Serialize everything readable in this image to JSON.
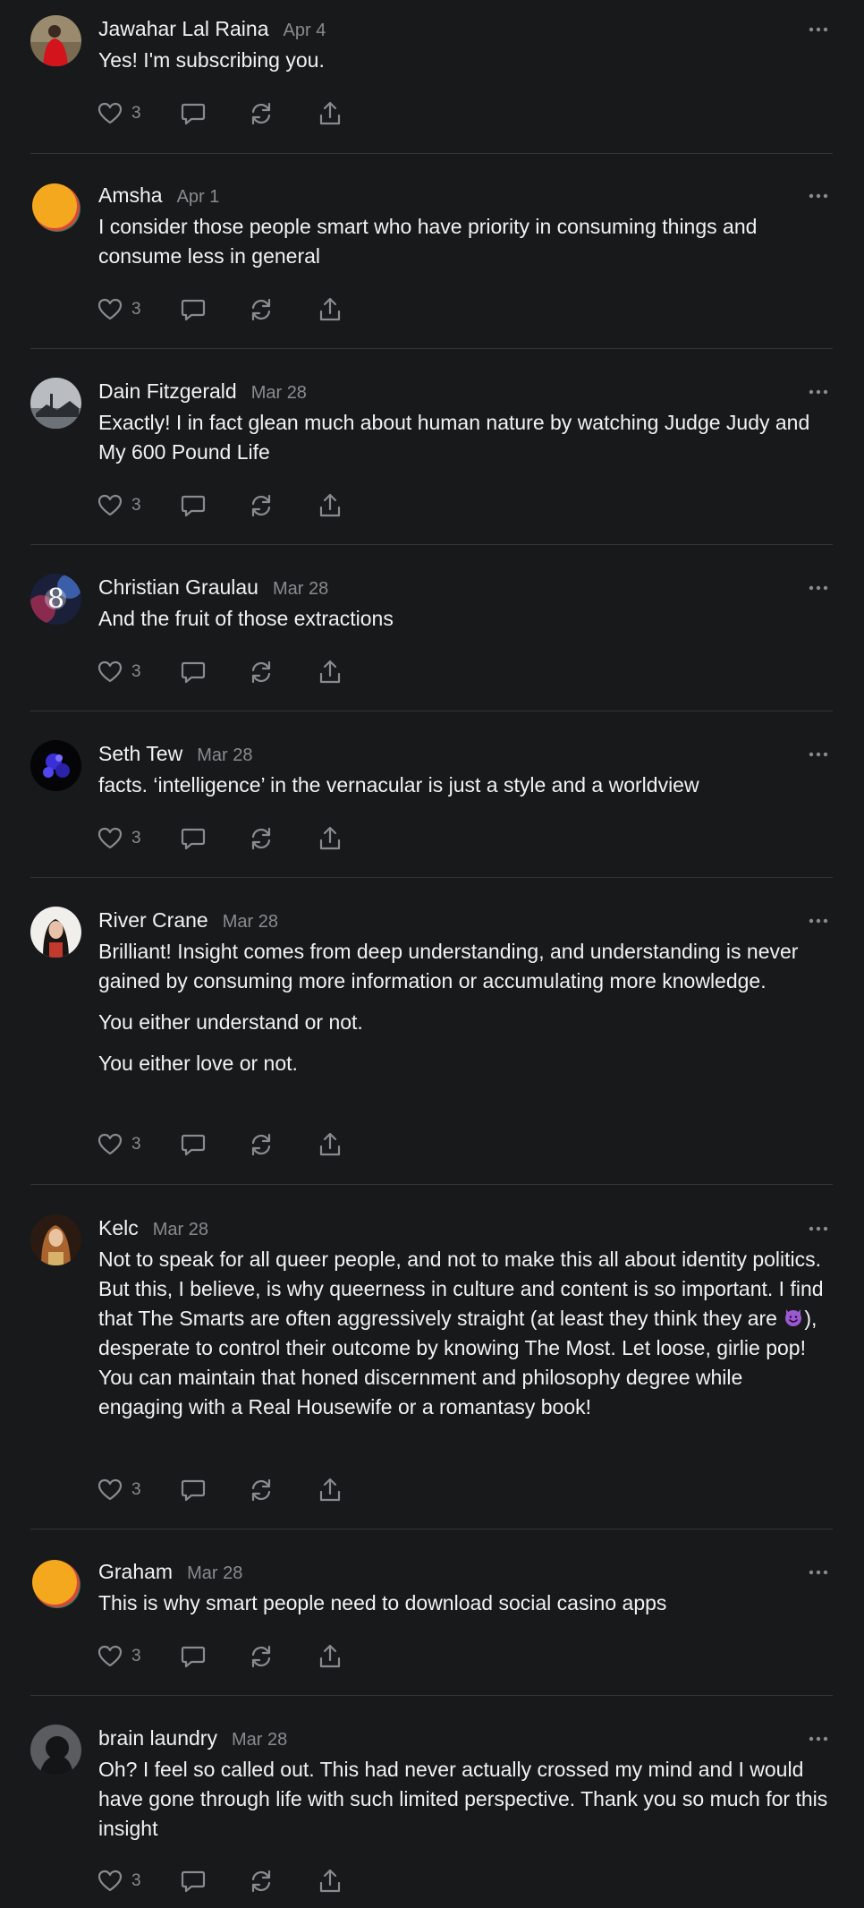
{
  "icons": {
    "like": "heart-icon",
    "reply": "comment-bubble-icon",
    "restack": "restack-icon",
    "share": "share-icon",
    "more": "more-horizontal-icon"
  },
  "colors": {
    "background": "#18191b",
    "text": "#f2f2f2",
    "muted": "#8a8b8e",
    "divider": "#333437"
  },
  "comments": [
    {
      "author": "Jawahar Lal Raina",
      "date": "Apr 4",
      "paragraphs": [
        "Yes! I'm subscribing you."
      ],
      "likes": "3"
    },
    {
      "author": "Amsha",
      "date": "Apr 1",
      "paragraphs": [
        "I consider those people smart who have priority in consuming things and consume less in general"
      ],
      "likes": "3"
    },
    {
      "author": "Dain Fitzgerald",
      "date": "Mar 28",
      "paragraphs": [
        "Exactly! I in fact glean much about human nature by watching Judge Judy and My 600 Pound Life"
      ],
      "likes": "3"
    },
    {
      "author": "Christian Graulau",
      "date": "Mar 28",
      "paragraphs": [
        "And the fruit of those extractions"
      ],
      "likes": "3"
    },
    {
      "author": "Seth Tew",
      "date": "Mar 28",
      "paragraphs": [
        "facts. ‘intelligence’ in the vernacular is just a style and a worldview"
      ],
      "likes": "3"
    },
    {
      "author": "River Crane",
      "date": "Mar 28",
      "paragraphs": [
        "Brilliant! Insight comes from deep understanding, and understanding is never gained by consuming more information or accumulating more knowledge.",
        "You either understand or not.",
        "You either love or not."
      ],
      "likes": "3"
    },
    {
      "author": "Kelc",
      "date": "Mar 28",
      "paragraph_before_emoji": "Not to speak for all queer people, and not to make this all about identity politics. But this, I believe, is why queerness in culture and content is so important. I find that The Smarts are often aggressively straight (at least they think they are ",
      "emoji": "smiling-devil-emoji",
      "paragraph_after_emoji": "), desperate to control their outcome by knowing The Most. Let loose, girlie pop! You can maintain that honed discernment and philosophy degree while engaging with a Real Housewife or a romantasy book!",
      "likes": "3"
    },
    {
      "author": "Graham",
      "date": "Mar 28",
      "paragraphs": [
        "This is why smart people need to download social casino apps"
      ],
      "likes": "3"
    },
    {
      "author": "brain laundry",
      "date": "Mar 28",
      "paragraphs": [
        "Oh? I feel so called out. This had never actually crossed my mind and I would have gone through life with such limited perspective. Thank you so much for this insight"
      ],
      "likes": "3"
    }
  ]
}
